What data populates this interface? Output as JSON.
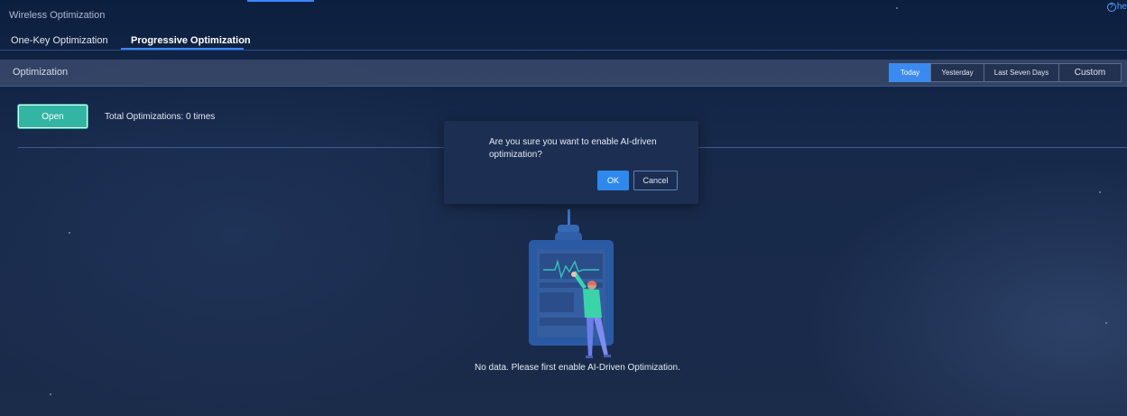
{
  "header": {
    "app_title": "Wireless Optimization",
    "help_label": "he"
  },
  "tabs": [
    {
      "label": "One-Key Optimization",
      "active": false
    },
    {
      "label": "Progressive Optimization",
      "active": true
    }
  ],
  "section": {
    "title": "Optimization",
    "time_filters": [
      {
        "label": "Today",
        "active": true
      },
      {
        "label": "Yesterday",
        "active": false
      },
      {
        "label": "Last Seven Days",
        "active": false
      },
      {
        "label": "Custom",
        "active": false
      }
    ]
  },
  "main": {
    "open_button": "Open",
    "total_optimizations": "Total Optimizations: 0 times",
    "empty_message": "No data. Please first enable AI-Driven Optimization."
  },
  "dialog": {
    "message": "Are you sure you want to enable AI-driven optimization?",
    "ok_label": "OK",
    "cancel_label": "Cancel"
  },
  "colors": {
    "accent": "#3a86ff",
    "primary_button": "#33b5a4",
    "active_filter": "#3b8aef",
    "background": "#1b2b4a"
  },
  "icons": {
    "help": "help-circle-icon",
    "illustration": "empty-state-illustration"
  }
}
